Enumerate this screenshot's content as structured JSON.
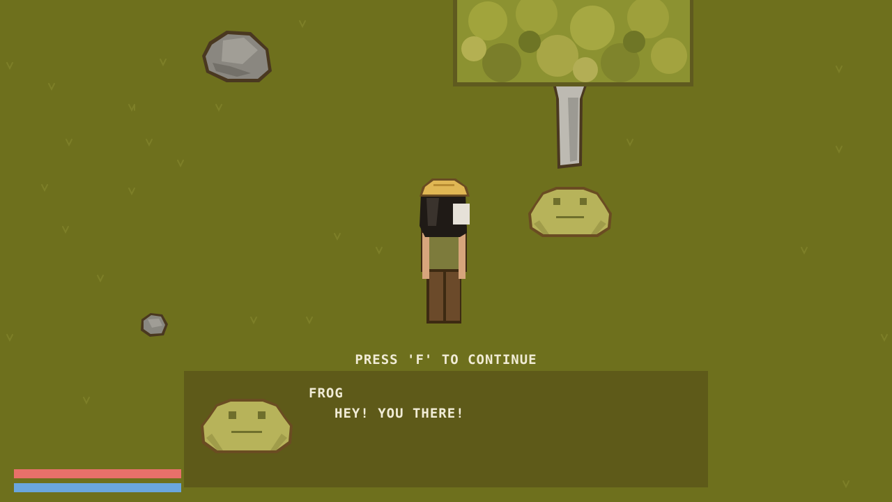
{
  "prompt": {
    "text": "PRESS 'F' TO CONTINUE"
  },
  "dialog": {
    "speaker": "FROG",
    "line": "HEY! YOU THERE!"
  },
  "hud": {
    "health": {
      "value": 1.0,
      "color": "#e8706a"
    },
    "mana": {
      "value": 1.0,
      "color": "#6aa6de"
    }
  },
  "colors": {
    "grass": "#6e701d",
    "dialog_bg": "#544e16"
  }
}
